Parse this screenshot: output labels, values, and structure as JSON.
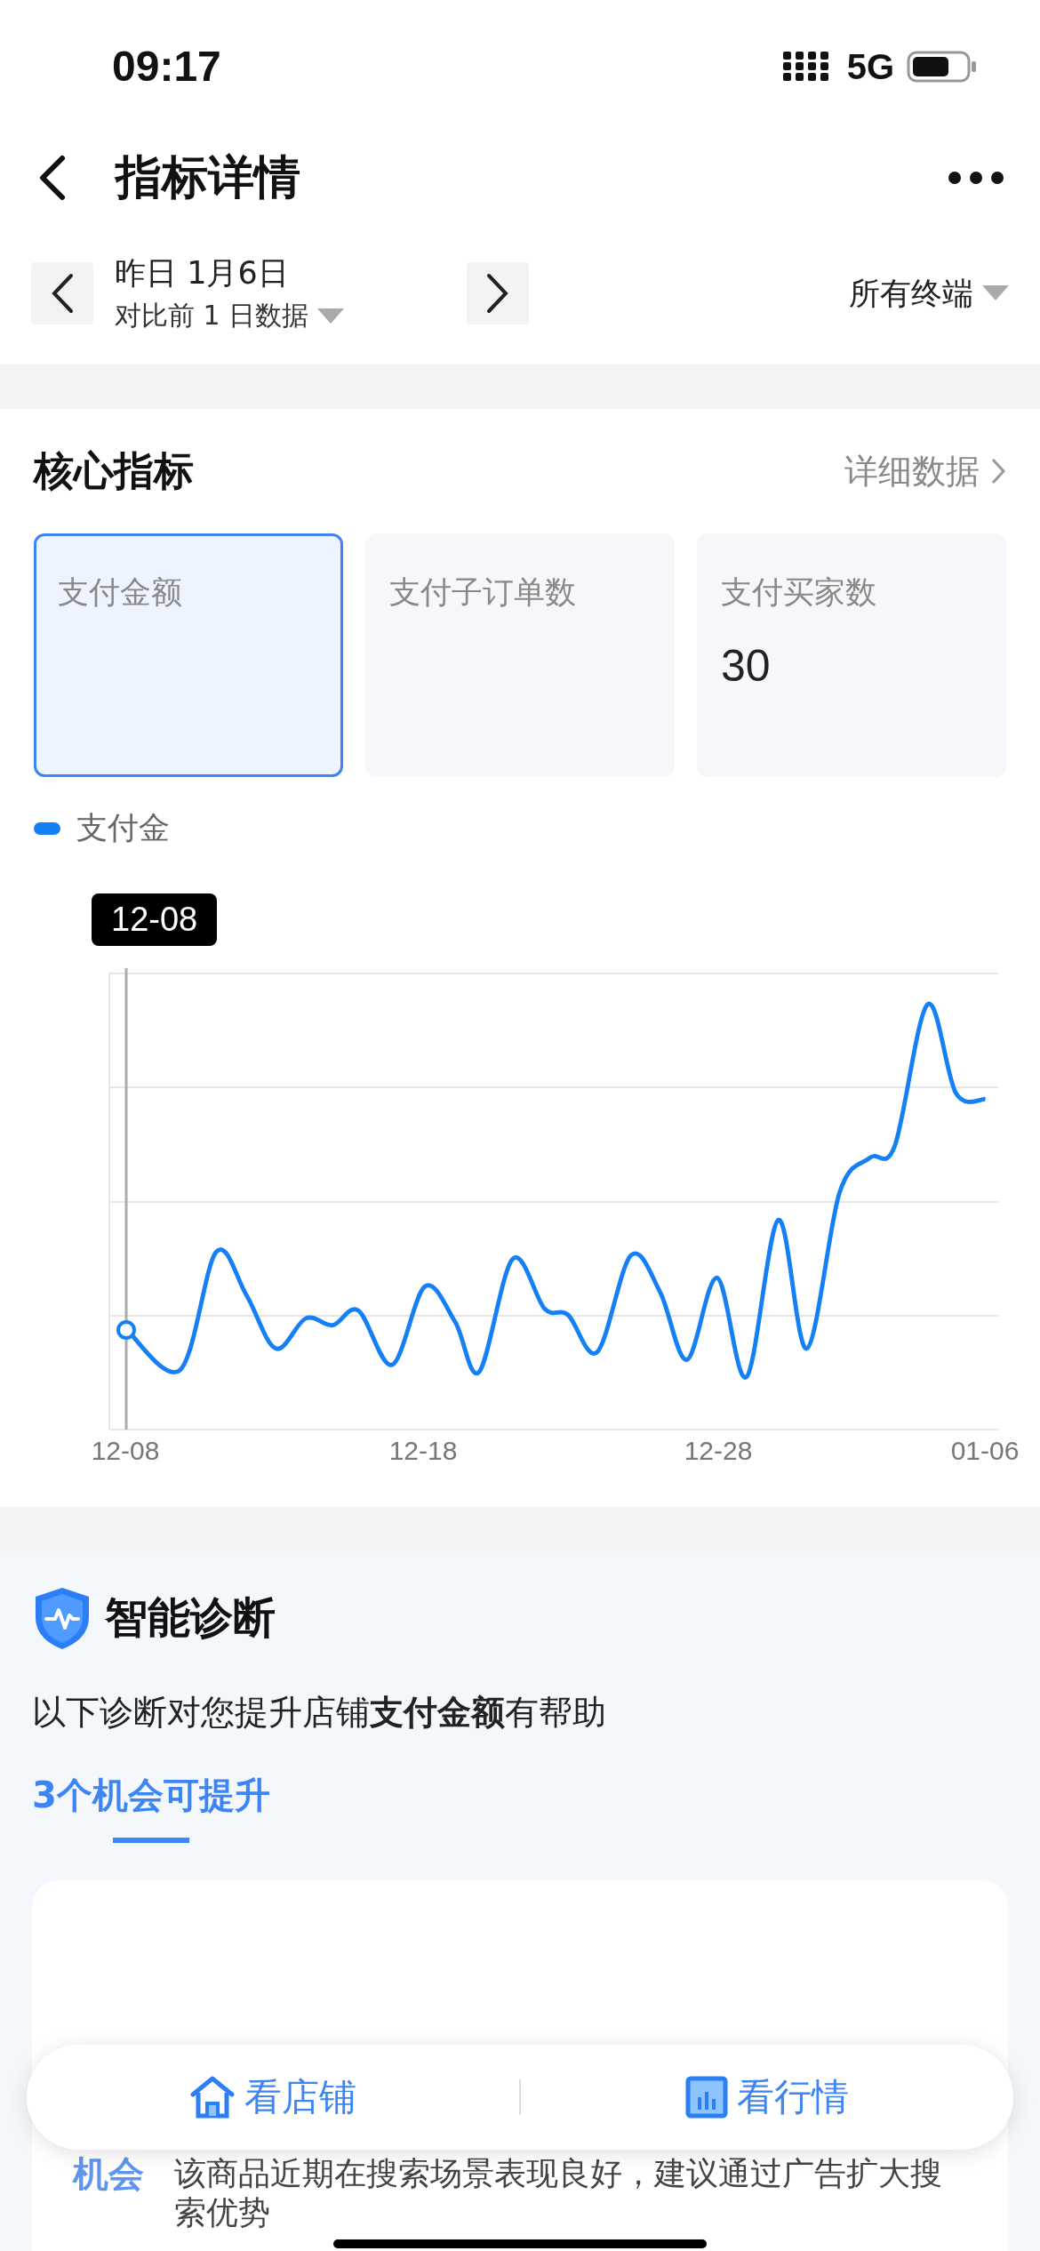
{
  "status_bar": {
    "time": "09:17",
    "network": "5G"
  },
  "nav": {
    "title": "指标详情"
  },
  "date_bar": {
    "date": "昨日 1月6日",
    "compare": "对比前 1 日数据",
    "terminal": "所有终端"
  },
  "core": {
    "title": "核心指标",
    "link": "详细数据",
    "cards": [
      {
        "label": "支付金额",
        "selected": true
      },
      {
        "label": "支付子订单数",
        "selected": false
      },
      {
        "label": "支付买家数",
        "value": "30",
        "selected": false
      }
    ],
    "legend": "支付金",
    "tooltip": "12-08",
    "x_labels": [
      "12-08",
      "12-18",
      "12-28",
      "01-06"
    ]
  },
  "diagnosis": {
    "title": "智能诊断",
    "sentence": "以下诊断对您提升店铺**支付金额**有帮助",
    "tabs": [
      {
        "label": "3个机会可提升",
        "selected": true
      }
    ],
    "item": {
      "tag": "机会",
      "text": "该商品近期在搜索场景表现良好，建议通过广告扩大搜索优势"
    }
  },
  "bottom_bar": [
    {
      "label": "看店铺",
      "kind": "store"
    },
    {
      "label": "看行情",
      "kind": "market"
    }
  ]
}
